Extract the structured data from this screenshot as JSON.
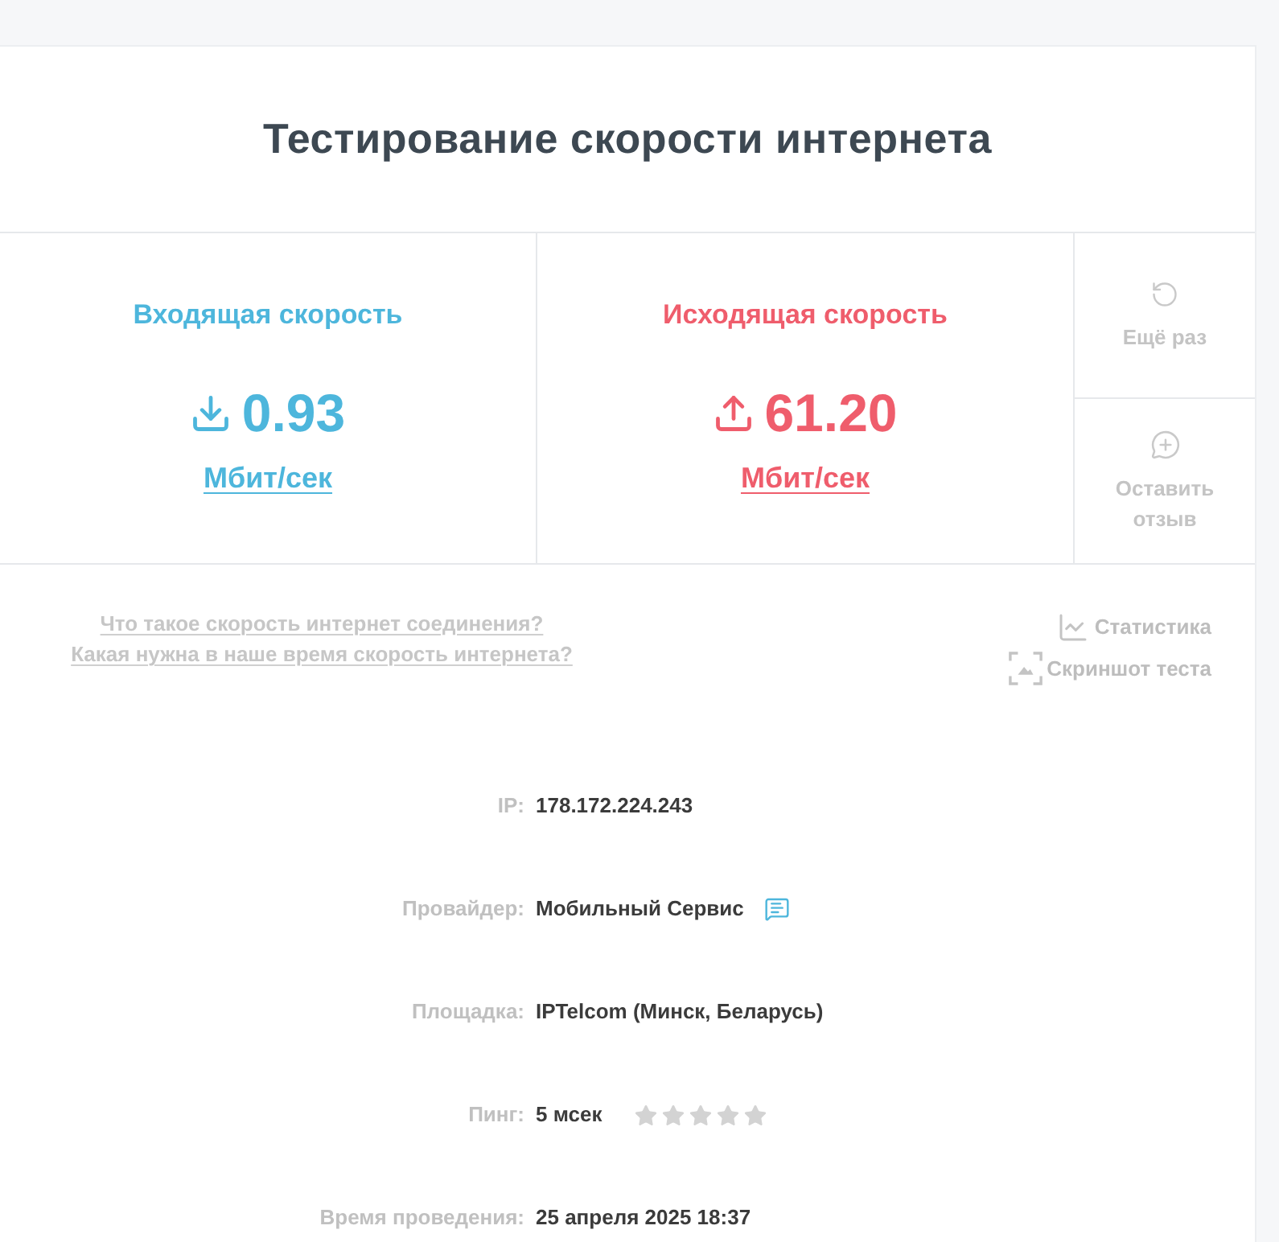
{
  "title": "Тестирование скорости интернета",
  "speeds": [
    {
      "kind": "download",
      "label": "Входящая скорость",
      "value": "0.93",
      "unit": "Мбит/сек"
    },
    {
      "kind": "upload",
      "label": "Исходящая скорость",
      "value": "61.20",
      "unit": "Мбит/сек"
    }
  ],
  "side_actions": [
    {
      "kind": "retry",
      "label": "Ещё раз"
    },
    {
      "kind": "feedback",
      "label": "Оставить отзыв"
    }
  ],
  "help_links": [
    "Что такое скорость интернет соединения?",
    "Какая нужна в наше время скорость интернета?"
  ],
  "tools": [
    {
      "kind": "stats",
      "label": "Статистика"
    },
    {
      "kind": "screenshot",
      "label": "Скриншот теста"
    }
  ],
  "details": [
    {
      "kind": "text",
      "label": "IP:",
      "value": "178.172.224.243"
    },
    {
      "kind": "provider",
      "label": "Провайдер:",
      "value": "Мобильный Сервис"
    },
    {
      "kind": "text",
      "label": "Площадка:",
      "value": "IPTelcom (Минск, Беларусь)"
    },
    {
      "kind": "ping",
      "label": "Пинг:",
      "value": "5 мсек",
      "stars": 0
    },
    {
      "kind": "text",
      "label": "Время проведения:",
      "value": "25 апреля 2025 18:37"
    }
  ]
}
